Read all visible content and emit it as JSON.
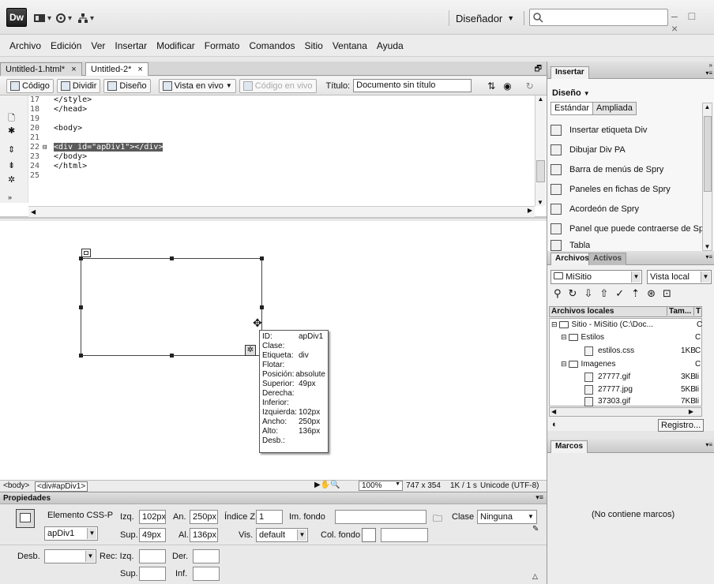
{
  "app": {
    "logo": "Dw",
    "workspace_label": "Diseñador",
    "window_buttons": "– □ ×"
  },
  "menu": [
    "Archivo",
    "Edición",
    "Ver",
    "Insertar",
    "Modificar",
    "Formato",
    "Comandos",
    "Sitio",
    "Ventana",
    "Ayuda"
  ],
  "doc_tabs": [
    {
      "label": "Untitled-1.html*",
      "close": "×"
    },
    {
      "label": "Untitled-2*",
      "close": "×"
    }
  ],
  "toolbar": {
    "code": "Código",
    "split": "Dividir",
    "design": "Diseño",
    "live_view": "Vista en vivo",
    "live_code": "Código en vivo",
    "title_label": "Título:",
    "title_value": "Documento sin título"
  },
  "code_lines": [
    {
      "num": "17",
      "text": "</style>"
    },
    {
      "num": "18",
      "text": "</head>"
    },
    {
      "num": "19",
      "text": ""
    },
    {
      "num": "20",
      "text": "<body>"
    },
    {
      "num": "21",
      "text": ""
    },
    {
      "num": "22",
      "text": "<div id=\"apDiv1\"></div>"
    },
    {
      "num": "23",
      "text": "</body>"
    },
    {
      "num": "24",
      "text": "</html>"
    },
    {
      "num": "25",
      "text": ""
    }
  ],
  "tooltip": [
    {
      "k": "ID:",
      "v": "apDiv1"
    },
    {
      "k": "Clase:",
      "v": ""
    },
    {
      "k": "Etiqueta:",
      "v": "div"
    },
    {
      "k": "Flotar:",
      "v": ""
    },
    {
      "k": "Posición:",
      "v": "absolute"
    },
    {
      "k": "Superior:",
      "v": "49px"
    },
    {
      "k": "Derecha:",
      "v": ""
    },
    {
      "k": "Inferior:",
      "v": ""
    },
    {
      "k": "Izquierda:",
      "v": "102px"
    },
    {
      "k": "Ancho:",
      "v": "250px"
    },
    {
      "k": "Alto:",
      "v": "136px"
    },
    {
      "k": "Desb.:",
      "v": ""
    }
  ],
  "status": {
    "tag1": "<body>",
    "tag2": "<div#apDiv1>",
    "zoom": "100%",
    "size": "747 x 354",
    "speed": "1K / 1 s",
    "encoding": "Unicode (UTF-8)"
  },
  "props": {
    "header": "Propiedades",
    "element": "Elemento CSS-P",
    "id_value": "apDiv1",
    "izq_label": "Izq.",
    "izq": "102px",
    "an_label": "An.",
    "an": "250px",
    "indice_label": "Índice Z",
    "indice": "1",
    "imfondo_label": "Im. fondo",
    "clase_label": "Clase",
    "clase": "Ninguna",
    "sup_label": "Sup.",
    "sup": "49px",
    "al_label": "Al.",
    "al": "136px",
    "vis_label": "Vis.",
    "vis": "default",
    "colfondo_label": "Col. fondo",
    "desb_label": "Desb.",
    "rec_label": "Rec: Izq.",
    "der_label": "Der.",
    "sup2_label": "Sup.",
    "inf_label": "Inf."
  },
  "insert_panel": {
    "tab": "Insertar",
    "category": "Diseño",
    "subtab1": "Estándar",
    "subtab2": "Ampliada",
    "items": [
      "Insertar etiqueta Div",
      "Dibujar Div PA",
      "Barra de menús de Spry",
      "Paneles en fichas de Spry",
      "Acordeón de Spry",
      "Panel que puede contraerse de Spry",
      "Tabla"
    ]
  },
  "files_panel": {
    "tab1": "Archivos",
    "tab2": "Activos",
    "site": "MiSitio",
    "view": "Vista local",
    "col1": "Archivos locales",
    "col2": "Tam...",
    "col3": "T",
    "rows": [
      {
        "name": "Sitio - MiSitio (C:\\Doc...",
        "size": "",
        "type": "C"
      },
      {
        "name": "Estilos",
        "size": "",
        "type": "C"
      },
      {
        "name": "estilos.css",
        "size": "1KB",
        "type": "C"
      },
      {
        "name": "Imagenes",
        "size": "",
        "type": "C"
      },
      {
        "name": "27777.gif",
        "size": "3KB",
        "type": "Ii"
      },
      {
        "name": "27777.jpg",
        "size": "5KB",
        "type": "Ii"
      },
      {
        "name": "37303.gif",
        "size": "7KB",
        "type": "Ii"
      }
    ],
    "log_button": "Registro..."
  },
  "frames_panel": {
    "tab": "Marcos",
    "empty": "(No contiene marcos)"
  }
}
